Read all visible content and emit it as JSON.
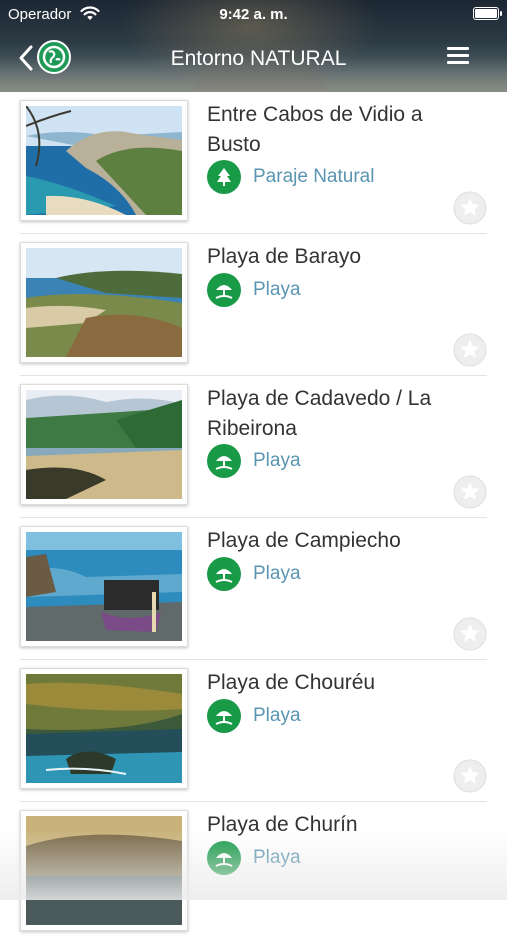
{
  "status": {
    "carrier": "Operador",
    "time": "9:42 a. m."
  },
  "header": {
    "title": "Entorno NATURAL"
  },
  "items": [
    {
      "name": "Entre Cabos de Vidio a Busto",
      "category": "Paraje Natural",
      "category_icon": "tree-icon"
    },
    {
      "name": "Playa de Barayo",
      "category": "Playa",
      "category_icon": "beach-umbrella-icon"
    },
    {
      "name": "Playa de Cadavedo / La Ribeirona",
      "category": "Playa",
      "category_icon": "beach-umbrella-icon"
    },
    {
      "name": "Playa de Campiecho",
      "category": "Playa",
      "category_icon": "beach-umbrella-icon"
    },
    {
      "name": "Playa de Chouréu",
      "category": "Playa",
      "category_icon": "beach-umbrella-icon"
    },
    {
      "name": "Playa de Churín",
      "category": "Playa",
      "category_icon": "beach-umbrella-icon"
    }
  ],
  "colors": {
    "accent_green": "#189a47",
    "category_text": "#5a95b2"
  }
}
